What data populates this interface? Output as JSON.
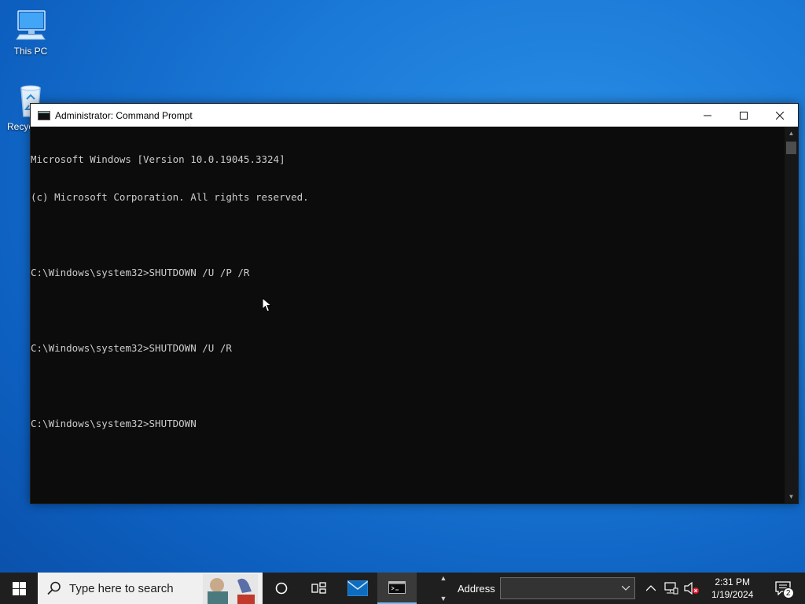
{
  "desktop": {
    "icons": [
      {
        "label": "This PC"
      },
      {
        "label": "Recyc"
      }
    ]
  },
  "window": {
    "title": "Administrator: Command Prompt",
    "controls": {
      "minimize": "—",
      "maximize": "☐",
      "close": "✕"
    },
    "console_lines": [
      "Microsoft Windows [Version 10.0.19045.3324]",
      "(c) Microsoft Corporation. All rights reserved.",
      "",
      "C:\\Windows\\system32>SHUTDOWN /U /P /R",
      "",
      "C:\\Windows\\system32>SHUTDOWN /U /R",
      "",
      "C:\\Windows\\system32>SHUTDOWN"
    ],
    "colors": {
      "background": "#0c0c0c",
      "text": "#cccccc"
    }
  },
  "taskbar": {
    "search_placeholder": "Type here to search",
    "address_label": "Address",
    "address_value": "",
    "clock": {
      "time": "2:31 PM",
      "date": "1/19/2024"
    },
    "notifications_count": "2",
    "icons": [
      "windows-start-icon",
      "search-icon",
      "cortana-icon",
      "task-view-icon",
      "mail-icon",
      "command-prompt-icon",
      "chevron-up-icon",
      "network-icon",
      "volume-muted-icon",
      "action-center-icon"
    ]
  }
}
